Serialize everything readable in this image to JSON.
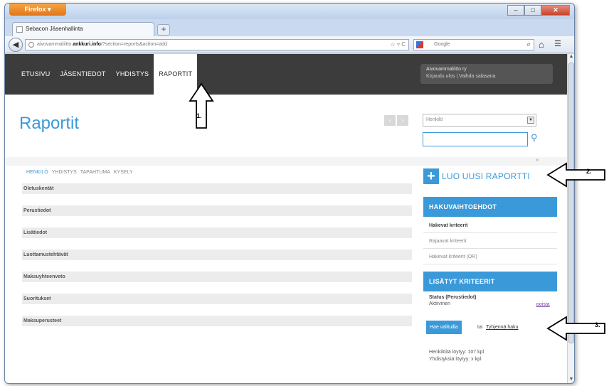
{
  "browser": {
    "app_button": "Firefox",
    "tab_title": "Sebacon Jäsenhallinta",
    "new_tab": "+",
    "url_prefix": "aivovammaliitto.",
    "url_domain": "ankkuri.info",
    "url_path": "/?section=reports&action=add",
    "search_engine": "Google",
    "window_controls": [
      "–",
      "□",
      "✕"
    ]
  },
  "site": {
    "nav": [
      "ETUSIVU",
      "JÄSENTIEDOT",
      "YHDISTYS",
      "RAPORTIT"
    ],
    "active_nav": "RAPORTIT",
    "org_name": "Aivovammaliitto ry",
    "user_links": "Kirjaudu ulos | Vaihda salasana"
  },
  "page": {
    "title": "Raportit",
    "pager_prev": "‹",
    "pager_next": "›",
    "entity_select": "Henkilö",
    "collapse_toggle": "»"
  },
  "subtabs": [
    "HENKILÖ",
    "YHDISTYS",
    "TAPAHTUMA",
    "KYSELY"
  ],
  "sections": [
    "Oletuskentät",
    "Perustiedot",
    "Lisätiedot",
    "Luottamustehtävät",
    "Maksuyhteenveto",
    "Suoritukset",
    "Maksuperusteet"
  ],
  "sidebar": {
    "add_report": "LUO UUSI RAPORTTI",
    "search_options_title": "HAKUVAIHTOEHDOT",
    "search_options": [
      "Hakevat kriteerit",
      "Rajaavat kriteerit",
      "Hakevat kriteerit (OR)"
    ],
    "added_criteria_title": "LISÄTYT KRITEERIT",
    "criterion_name": "Status (Perustiedot)",
    "criterion_value": "Aktiivinen",
    "criterion_remove": "poista",
    "search_selected": "Hae valituilla",
    "or_text": "tai",
    "clear_search": "Tyhjennä haku",
    "results": [
      "Henkilöitä löytyy: 107 kpl",
      "Yhdistyksiä löytyy: x kpl"
    ]
  },
  "annotations": [
    "1.",
    "2.",
    "3."
  ],
  "colors": {
    "accent": "#3a9ad9",
    "header_bg": "#3c3c3c",
    "firefox_orange": "#e1761a"
  }
}
